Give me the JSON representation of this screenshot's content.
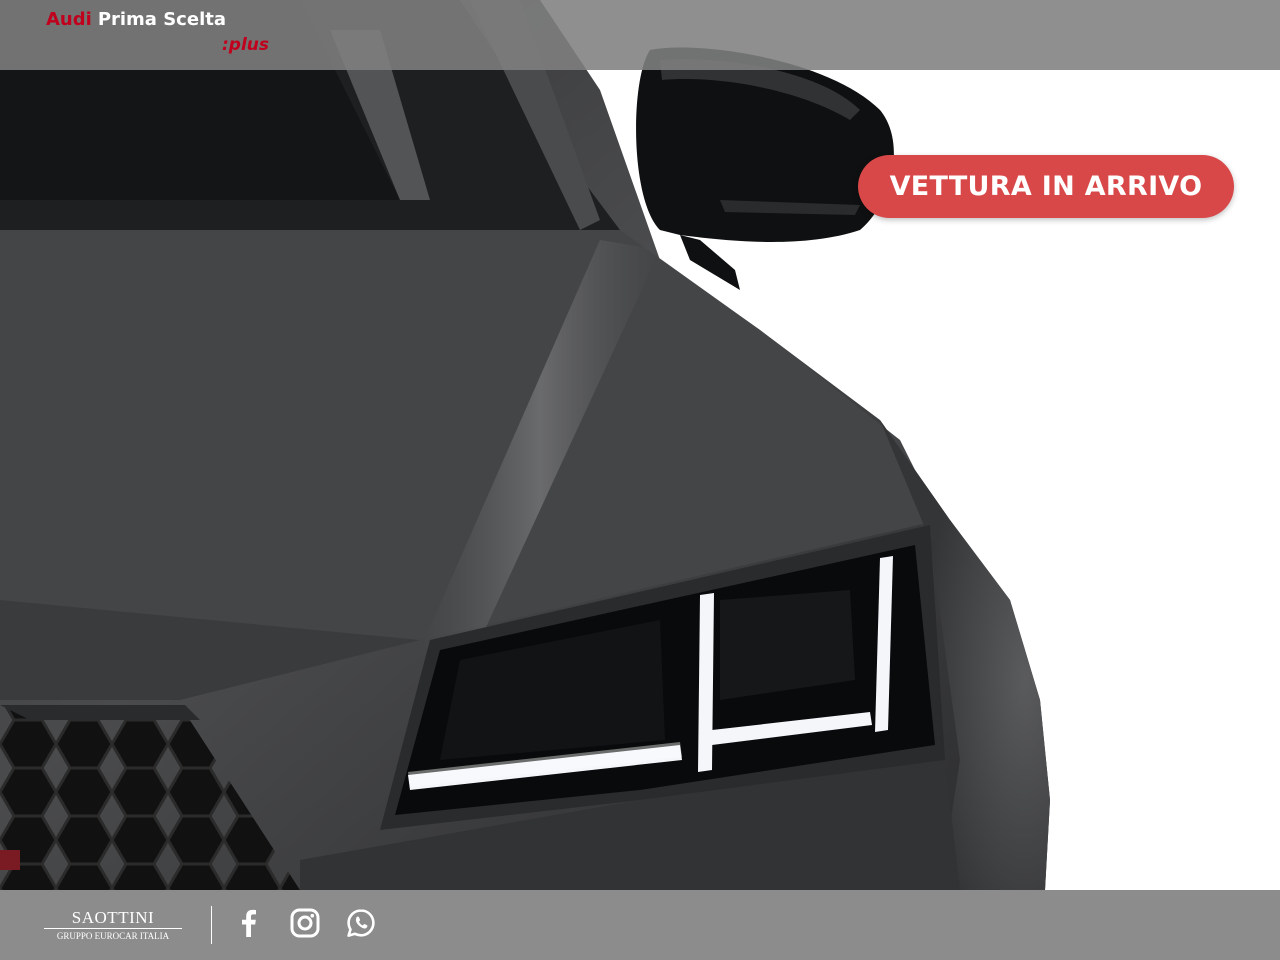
{
  "header": {
    "brand_audi": "Audi",
    "brand_name": "Prima Scelta",
    "brand_sub": ":plus"
  },
  "badge": {
    "label": "VETTURA IN ARRIVO"
  },
  "footer": {
    "dealer_name": "SAOTTINI",
    "dealer_subtitle": "GRUPPO EUROCAR ITALIA",
    "social_icons": [
      "facebook-icon",
      "instagram-icon",
      "whatsapp-icon"
    ]
  },
  "colors": {
    "brand_red": "#c0001d",
    "badge_red": "#d94849",
    "bar_gray": "#808080",
    "car_body": "#3d3e40"
  }
}
